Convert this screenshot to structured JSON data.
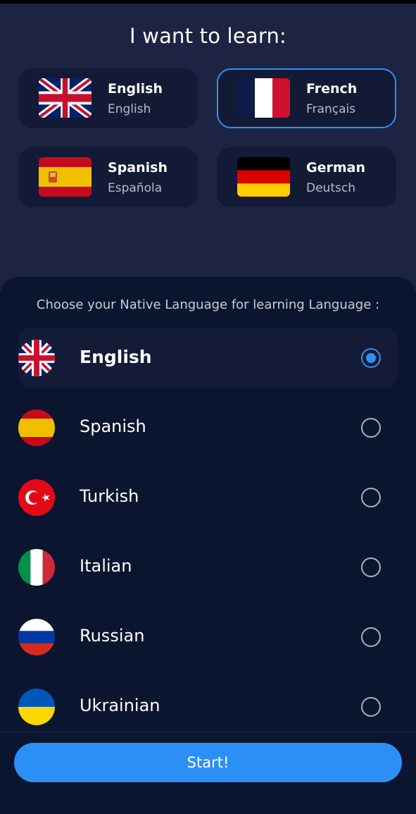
{
  "header": {
    "title": "I want to learn:"
  },
  "learn_options": [
    {
      "name": "English",
      "native": "English",
      "flag": "uk-flag-icon",
      "selected": false
    },
    {
      "name": "French",
      "native": "Français",
      "flag": "france-flag-icon",
      "selected": true
    },
    {
      "name": "Spanish",
      "native": "Española",
      "flag": "spain-flag-icon",
      "selected": false
    },
    {
      "name": "German",
      "native": "Deutsch",
      "flag": "germany-flag-icon",
      "selected": false
    }
  ],
  "native_section": {
    "subtitle": "Choose your Native Language for learning Language :",
    "items": [
      {
        "label": "English",
        "flag": "uk-flag-icon",
        "selected": true
      },
      {
        "label": "Spanish",
        "flag": "spain-flag-icon",
        "selected": false
      },
      {
        "label": "Turkish",
        "flag": "turkey-flag-icon",
        "selected": false
      },
      {
        "label": "Italian",
        "flag": "italy-flag-icon",
        "selected": false
      },
      {
        "label": "Russian",
        "flag": "russia-flag-icon",
        "selected": false
      },
      {
        "label": "Ukrainian",
        "flag": "ukraine-flag-icon",
        "selected": false
      }
    ]
  },
  "start_button": {
    "label": "Start!"
  },
  "colors": {
    "accent": "#2f8ff5",
    "background": "#0c1530",
    "top_panel": "#1d2342",
    "card": "#121a35"
  }
}
